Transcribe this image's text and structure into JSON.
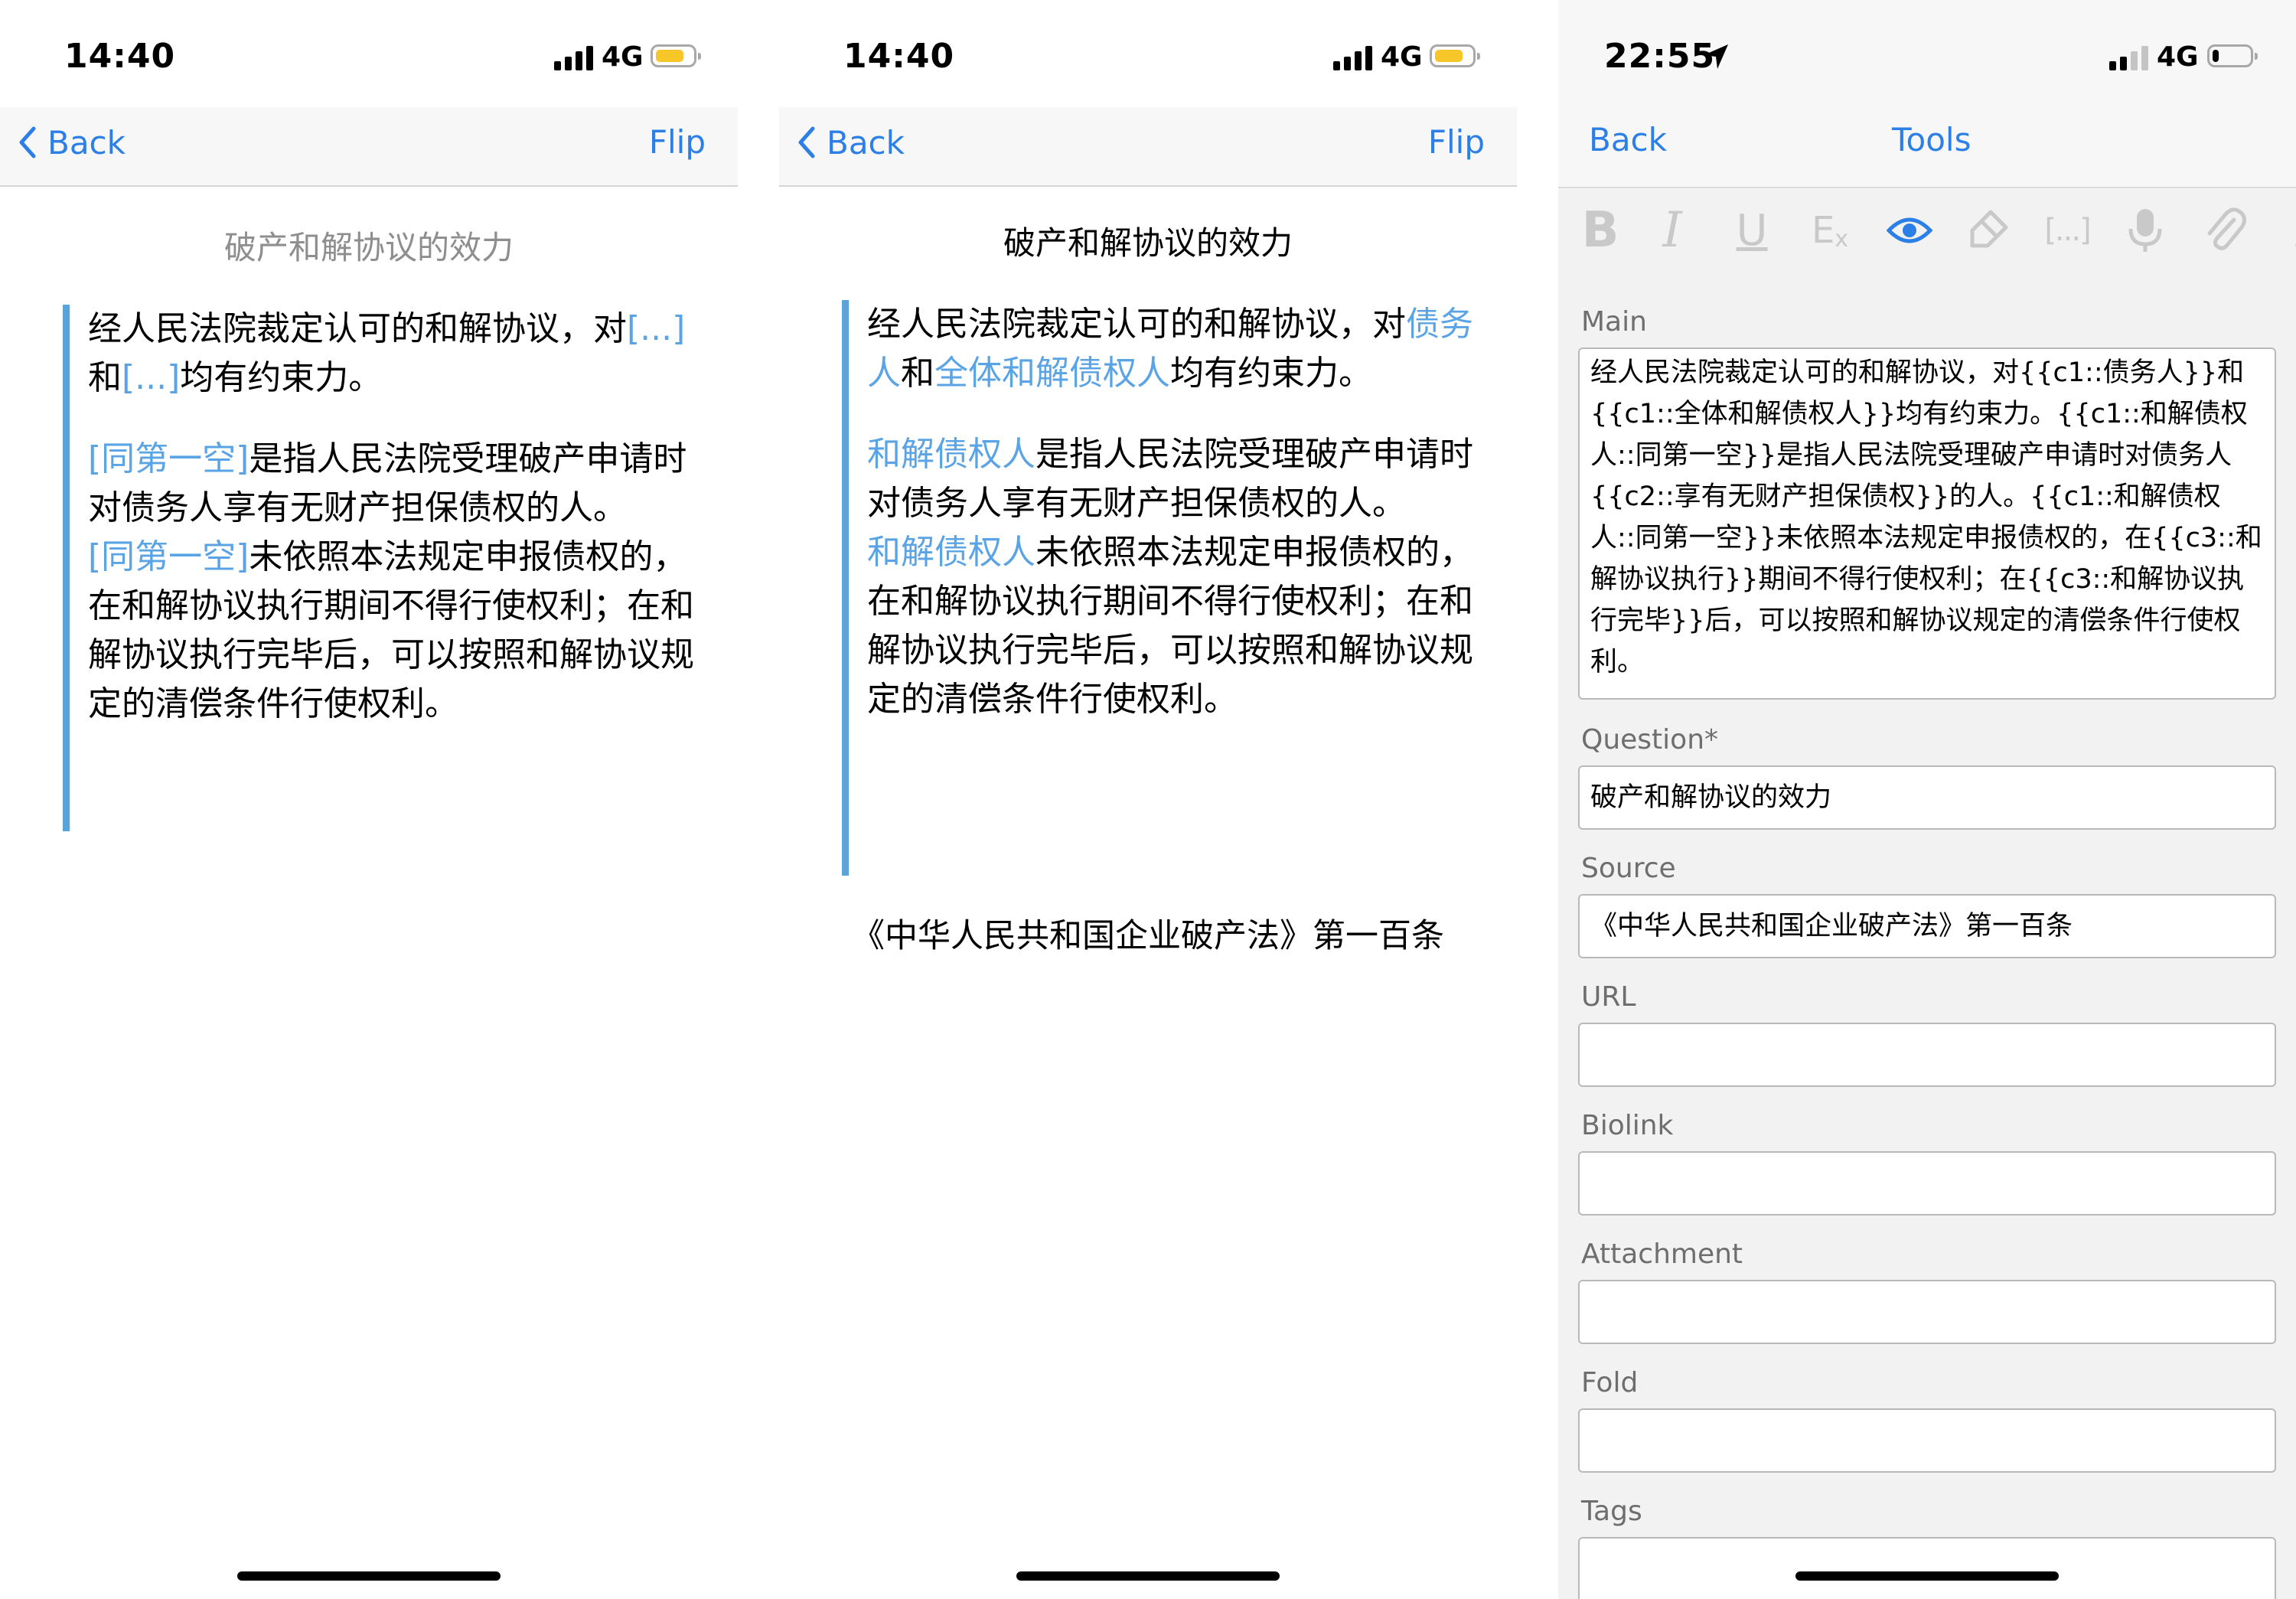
{
  "panels": {
    "front": {
      "status": {
        "time": "14:40",
        "network": "4G"
      },
      "nav": {
        "back_label": "Back",
        "flip_label": "Flip"
      },
      "title": "破产和解协议的效力",
      "para1": {
        "t1": "经人民法院裁定认可的和解协议，对",
        "b1": "[...]",
        "t2": "和",
        "b2": "[...]",
        "t3": "均有约束力。"
      },
      "para2": {
        "b1": "[同第一空]",
        "t1": "是指人民法院受理破产申请时对债务人享有无财产担保债权的人。",
        "b2": "[同第一空]",
        "t2": "未依照本法规定申报债权的，在和解协议执行期间不得行使权利；在和解协议执行完毕后，可以按照和解协议规定的清偿条件行使权利。"
      }
    },
    "back": {
      "status": {
        "time": "14:40",
        "network": "4G"
      },
      "nav": {
        "back_label": "Back",
        "flip_label": "Flip"
      },
      "title": "破产和解协议的效力",
      "para1": {
        "t1": "经人民法院裁定认可的和解协议，对",
        "a1": "债务人",
        "t2": "和",
        "a2": "全体和解债权人",
        "t3": "均有约束力。"
      },
      "para2": {
        "a1": "和解债权人",
        "t1": "是指人民法院受理破产申请时对债务人享有无财产担保债权的人。",
        "a2": "和解债权人",
        "t2": "未依照本法规定申报债权的，在和解协议执行期间不得行使权利；在和解协议执行完毕后，可以按照和解协议规定的清偿条件行使权利。"
      },
      "source": "《中华人民共和国企业破产法》第一百条"
    },
    "editor": {
      "status": {
        "time": "22:55",
        "network": "4G"
      },
      "nav": {
        "back_label": "Back",
        "tools_label": "Tools"
      },
      "toolbar_icons": [
        "bold-icon",
        "italic-icon",
        "underline-icon",
        "clear-format-icon",
        "eye-icon",
        "highlighter-icon",
        "cloze-icon",
        "microphone-icon",
        "paperclip-icon"
      ],
      "fields": {
        "main_label": "Main",
        "main_value": "经人民法院裁定认可的和解协议，对{{c1::债务人}}和{{c1::全体和解债权人}}均有约束力。{{c1::和解债权人::同第一空}}是指人民法院受理破产申请时对债务人{{c2::享有无财产担保债权}}的人。{{c1::和解债权人::同第一空}}未依照本法规定申报债权的，在{{c3::和解协议执行}}期间不得行使权利；在{{c3::和解协议执行完毕}}后，可以按照和解协议规定的清偿条件行使权利。",
        "question_label": "Question*",
        "question_value": "破产和解协议的效力",
        "source_label": "Source",
        "source_value": "《中华人民共和国企业破产法》第一百条",
        "url_label": "URL",
        "biolink_label": "Biolink",
        "attachment_label": "Attachment",
        "fold_label": "Fold",
        "tags_label": "Tags"
      }
    }
  },
  "colors": {
    "accent": "#2c7fe6",
    "cloze": "#5aa4e6",
    "quote_bar": "#5aa4d9",
    "battery_yellow": "#f7c72a",
    "icon_active": "#2c7fe6",
    "icon_inactive": "#c9c9c9"
  }
}
